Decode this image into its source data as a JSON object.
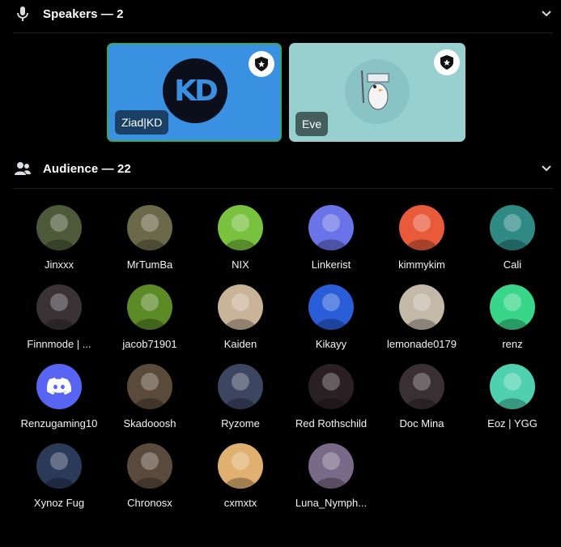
{
  "speakers": {
    "title": "Speakers — 2",
    "icon": "microphone-icon",
    "tiles": [
      {
        "name": "Ziad|KD",
        "bg": "#3b91e1",
        "avatar_text": "KD"
      },
      {
        "name": "Eve",
        "bg": "#98cfcf"
      }
    ]
  },
  "audience": {
    "title": "Audience — 22",
    "icon": "people-icon",
    "members": [
      {
        "name": "Jinxxx",
        "color": "#4d5a3a"
      },
      {
        "name": "MrTumBa",
        "color": "#6a6a4a"
      },
      {
        "name": "NIX",
        "color": "#79c23f"
      },
      {
        "name": "Linkerist",
        "color": "#6a74e8"
      },
      {
        "name": "kimmykim",
        "color": "#e85a3a"
      },
      {
        "name": "Cali",
        "color": "#2f8a86"
      },
      {
        "name": "Finnmode | ...",
        "color": "#3a3336"
      },
      {
        "name": "jacob71901",
        "color": "#5c8a26"
      },
      {
        "name": "Kaiden",
        "color": "#c9b49a"
      },
      {
        "name": "Kikayy",
        "color": "#2a5ed8"
      },
      {
        "name": "lemonade0179",
        "color": "#c4b8a8"
      },
      {
        "name": "renz",
        "color": "#39d68a"
      },
      {
        "name": "Renzugaming10",
        "color": "#5865f2"
      },
      {
        "name": "Skadooosh",
        "color": "#5a4a3a"
      },
      {
        "name": "Ryzome",
        "color": "#3c4660"
      },
      {
        "name": "Red Rothschild",
        "color": "#2a1f22"
      },
      {
        "name": "Doc Mina",
        "color": "#3a3034"
      },
      {
        "name": "Eoz | YGG",
        "color": "#4fd0b0"
      },
      {
        "name": "Xynoz Fug",
        "color": "#2c3a5a"
      },
      {
        "name": "Chronosx",
        "color": "#5a4a3e"
      },
      {
        "name": "cxmxtx",
        "color": "#e0b070"
      },
      {
        "name": "Luna_Nymph...",
        "color": "#7a6a8a"
      }
    ]
  }
}
